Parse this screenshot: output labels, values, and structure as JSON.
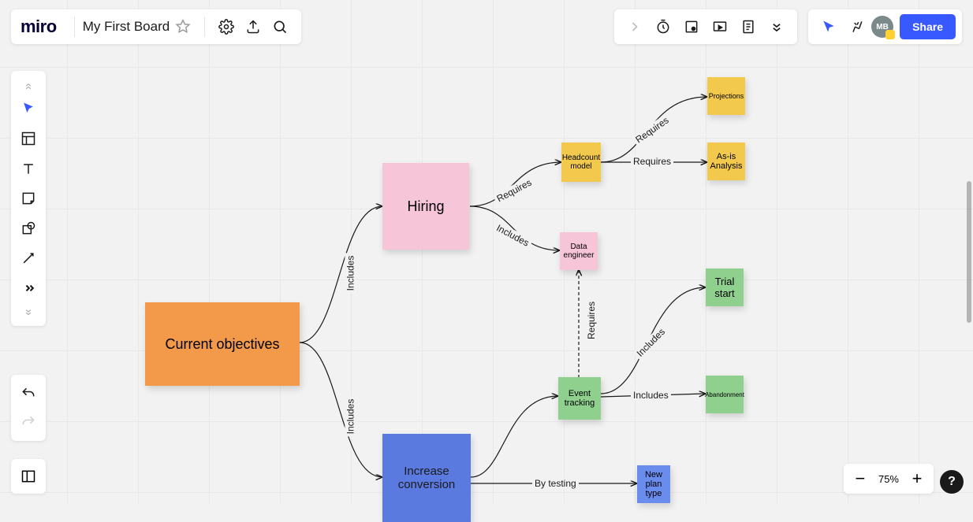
{
  "app": {
    "name": "miro"
  },
  "board": {
    "title": "My First Board"
  },
  "topbar_right": {
    "share_label": "Share",
    "avatar_initials": "MB"
  },
  "zoom": {
    "level": "75%"
  },
  "help": {
    "label": "?"
  },
  "nodes": {
    "objectives": "Current objectives",
    "hiring": "Hiring",
    "increase_conversion": "Increase conversion",
    "headcount_model": "Headcount model",
    "data_engineer": "Data engineer",
    "projections": "Projections",
    "as_is_analysis": "As-is Analysis",
    "event_tracking": "Event tracking",
    "trial_start": "Trial start",
    "abandonment": "Abandonment",
    "new_plan_type": "New plan type"
  },
  "edges": {
    "includes": "Includes",
    "requires": "Requires",
    "by_testing": "By testing"
  },
  "diagram": {
    "root": "Current objectives",
    "branches": [
      {
        "label": "Includes",
        "to": "Hiring",
        "children": [
          {
            "label": "Requires",
            "to": "Headcount model",
            "children": [
              {
                "label": "Requires",
                "to": "Projections"
              },
              {
                "label": "Requires",
                "to": "As-is Analysis"
              }
            ]
          },
          {
            "label": "Includes",
            "to": "Data engineer",
            "children": [
              {
                "label": "Requires",
                "to": "Event tracking",
                "style": "dashed"
              }
            ]
          }
        ]
      },
      {
        "label": "Includes",
        "to": "Increase conversion",
        "children": [
          {
            "label": "",
            "to": "Event tracking",
            "children": [
              {
                "label": "Includes",
                "to": "Trial start"
              },
              {
                "label": "Includes",
                "to": "Abandonment"
              }
            ]
          },
          {
            "label": "By testing",
            "to": "New plan type"
          }
        ]
      }
    ]
  },
  "colors": {
    "orange": "#f2994a",
    "pink": "#f7c5d8",
    "blue": "#5b7ae0",
    "yellow": "#f2c94c",
    "green": "#8fd08f",
    "accent": "#3859ff"
  }
}
